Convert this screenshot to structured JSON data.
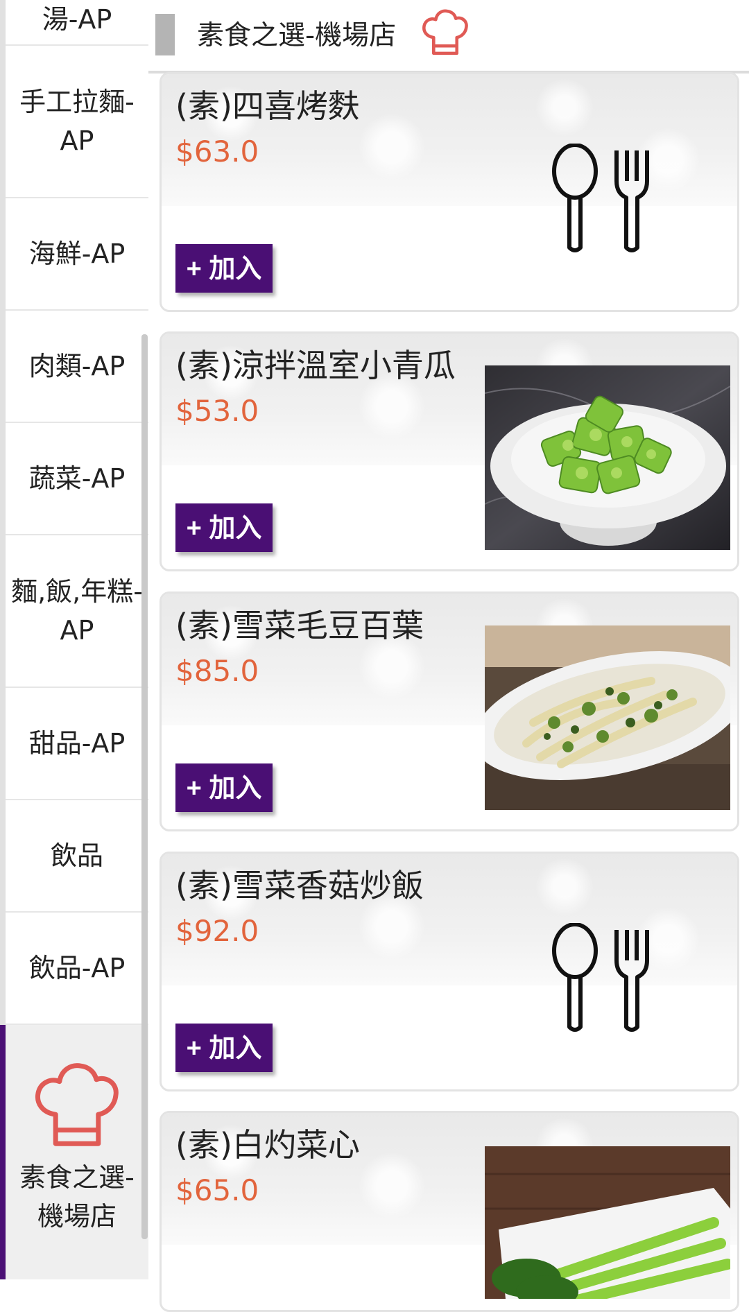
{
  "sidebar": {
    "items": [
      {
        "label": "湯-AP"
      },
      {
        "label": "手工拉麵-AP"
      },
      {
        "label": "海鮮-AP"
      },
      {
        "label": "肉類-AP"
      },
      {
        "label": "蔬菜-AP"
      },
      {
        "label": "麵,飯,年糕-AP"
      },
      {
        "label": "甜品-AP"
      },
      {
        "label": "飲品"
      },
      {
        "label": "飲品-AP"
      }
    ],
    "active": {
      "label": "素食之選-機場店",
      "icon": "chef-hat-icon"
    }
  },
  "header": {
    "title": "素食之選-機場店",
    "icon": "chef-hat-icon"
  },
  "menu": {
    "add_label": "+ 加入",
    "items": [
      {
        "name": "(素)四喜烤麩",
        "price": "$63.0",
        "image": "utensils-placeholder-icon"
      },
      {
        "name": "(素)涼拌溫室小青瓜",
        "price": "$53.0",
        "image": "cucumber-dish-photo"
      },
      {
        "name": "(素)雪菜毛豆百葉",
        "price": "$85.0",
        "image": "tofu-skin-dish-photo"
      },
      {
        "name": "(素)雪菜香菇炒飯",
        "price": "$92.0",
        "image": "utensils-placeholder-icon"
      },
      {
        "name": "(素)白灼菜心",
        "price": "$65.0",
        "image": "choy-sum-dish-photo"
      }
    ]
  },
  "colors": {
    "accent": "#4a0f74",
    "price": "#e2643c",
    "chef_hat": "#e05a55"
  }
}
